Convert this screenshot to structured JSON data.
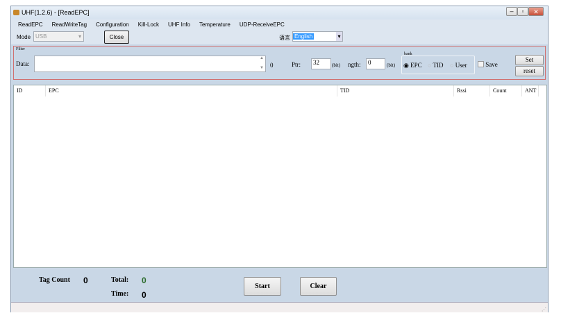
{
  "window": {
    "title": "UHF(1.2.6) - [ReadEPC]"
  },
  "menu": [
    "ReadEPC",
    "ReadWriteTag",
    "Configuration",
    "Kill-Lock",
    "UHF Info",
    "Temperature",
    "UDP-ReceiveEPC"
  ],
  "toolbar": {
    "mode_label": "Mode",
    "mode_value": "USB",
    "close_label": "Close",
    "language_label": "语言",
    "language_value": "English"
  },
  "filter": {
    "group_label": "Filter",
    "data_label": "Data:",
    "data_value": "",
    "data_count": "0",
    "ptr_label": "Ptr:",
    "ptr_value": "32",
    "bit1": "(bit)",
    "length_label": "ngth:",
    "length_value": "0",
    "bit2": "(bit)",
    "bank_label": "bank",
    "bank_options": [
      "EPC",
      "TID",
      "User"
    ],
    "bank_selected": "EPC",
    "save_label": "Save",
    "set_label": "Set",
    "reset_label": "reset"
  },
  "table": {
    "columns": [
      "ID",
      "EPC",
      "TID",
      "Rssi",
      "Count",
      "ANT"
    ]
  },
  "footer": {
    "tag_count_label": "Tag Count",
    "tag_count": "0",
    "total_label": "Total:",
    "total": "0",
    "time_label": "Time:",
    "time": "0",
    "start_label": "Start",
    "clear_label": "Clear"
  }
}
